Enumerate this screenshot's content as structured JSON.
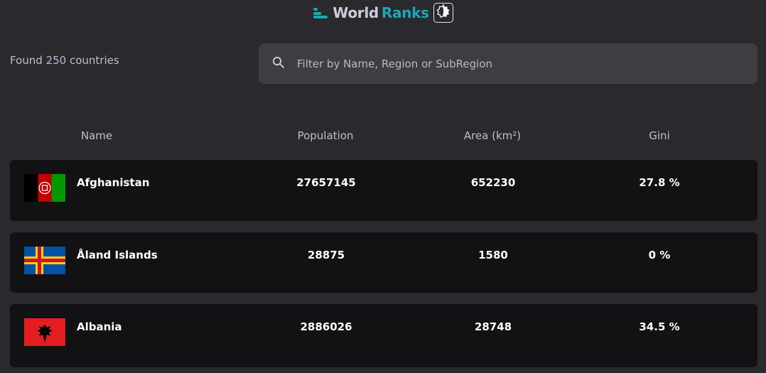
{
  "header": {
    "brand_first": "World",
    "brand_second": "Ranks",
    "accent": "#1ba8b5",
    "logo_icon": "bars-logo-icon",
    "toggle_icon": "theme-toggle-icon"
  },
  "summary": {
    "found_text": "Found 250 countries"
  },
  "search": {
    "placeholder": "Filter by Name, Region or SubRegion",
    "value": "",
    "icon": "search-icon"
  },
  "table": {
    "columns": [
      "Name",
      "Population",
      "Area (km²)",
      "Gini"
    ],
    "rows": [
      {
        "name": "Afghanistan",
        "population": "27657145",
        "area": "652230",
        "gini": "27.8 %",
        "flag": "afghanistan-flag"
      },
      {
        "name": "Åland Islands",
        "population": "28875",
        "area": "1580",
        "gini": "0 %",
        "flag": "aland-islands-flag"
      },
      {
        "name": "Albania",
        "population": "2886026",
        "area": "28748",
        "gini": "34.5 %",
        "flag": "albania-flag"
      }
    ]
  }
}
